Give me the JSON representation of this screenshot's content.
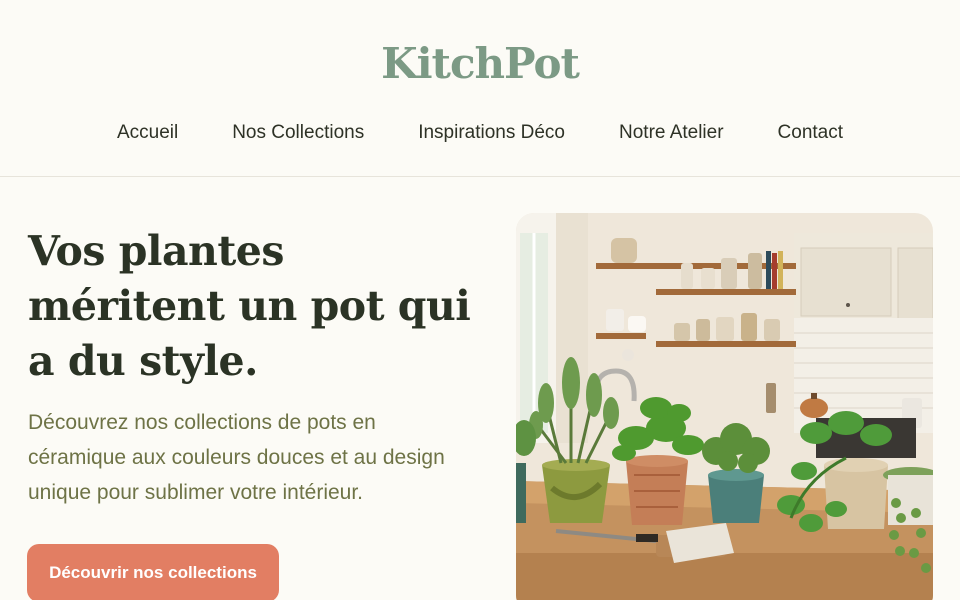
{
  "header": {
    "logo": "KitchPot",
    "nav": [
      {
        "label": "Accueil"
      },
      {
        "label": "Nos Collections"
      },
      {
        "label": "Inspirations Déco"
      },
      {
        "label": "Notre Atelier"
      },
      {
        "label": "Contact"
      }
    ]
  },
  "hero": {
    "title_lines": [
      "Vos plantes",
      "méritent un pot qui",
      "a du style."
    ],
    "description": "Découvrez nos collections de pots en céramique aux couleurs douces et au design unique pour sublimer votre intérieur.",
    "cta_label": "Découvrir nos collections"
  },
  "colors": {
    "background": "#fcfbf6",
    "logo": "#7c9a85",
    "title": "#2b3325",
    "description": "#6e7346",
    "cta": "#e27e63"
  }
}
